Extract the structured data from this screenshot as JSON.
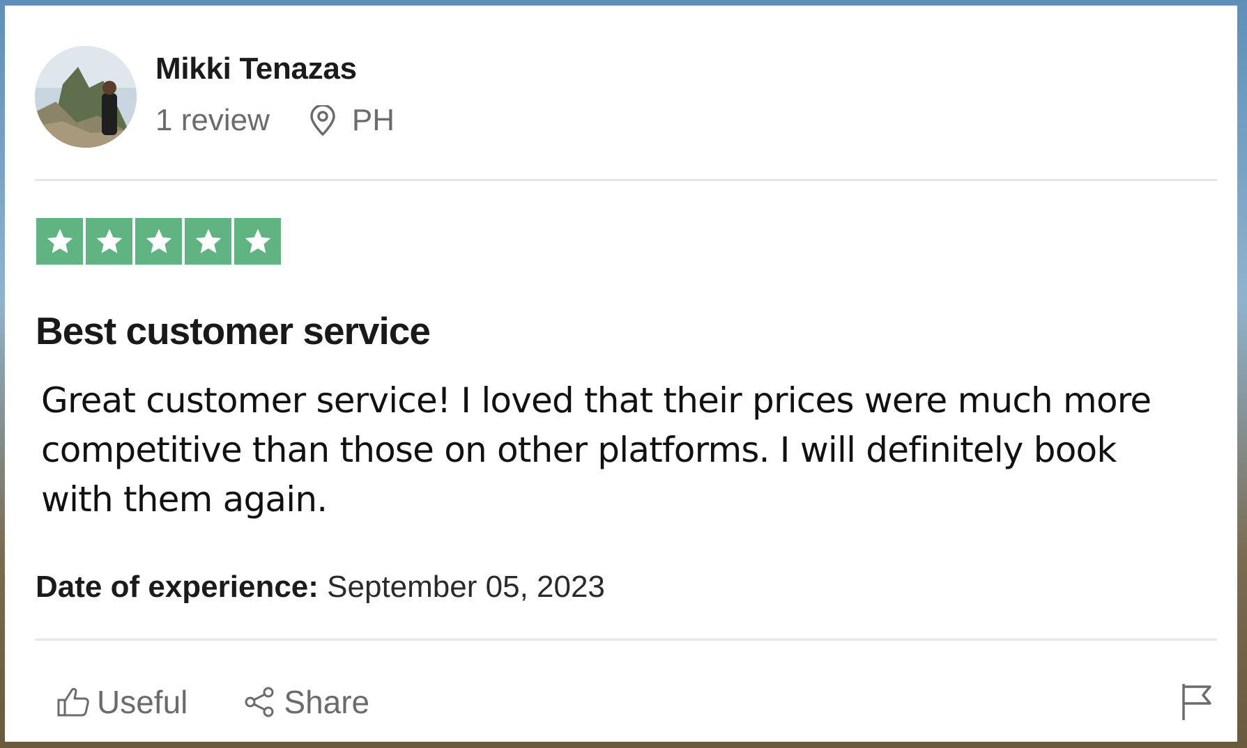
{
  "reviewer": {
    "name": "Mikki Tenazas",
    "review_count": "1 review",
    "location": "PH"
  },
  "rating": {
    "stars": 5,
    "max_stars": 5,
    "star_color": "#5fb482"
  },
  "review": {
    "title": "Best customer service",
    "body": "Great customer service! I loved that their prices were much more competitive than those on other platforms. I will definitely book with them again."
  },
  "experience": {
    "label": "Date of experience:",
    "date": "September 05, 2023"
  },
  "actions": {
    "useful_label": "Useful",
    "share_label": "Share"
  },
  "icons": {
    "location": "location-pin-icon",
    "useful": "thumbs-up-icon",
    "share": "share-icon",
    "report": "flag-icon"
  }
}
